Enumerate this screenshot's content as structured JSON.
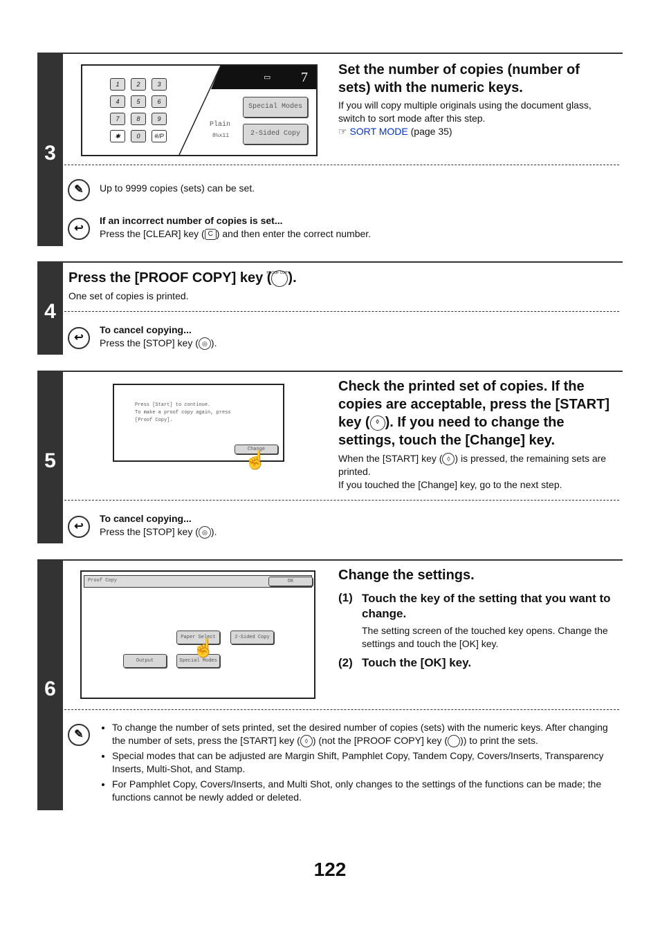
{
  "steps": [
    {
      "number": "3",
      "title": "Set the number of copies (number of sets) with the numeric keys.",
      "body": "If you will copy multiple originals using the document glass, switch to sort mode after this step.",
      "ref_link": "SORT MODE",
      "ref_page": "(page 35)",
      "screen": {
        "keys": [
          "1",
          "2",
          "3",
          "4",
          "5",
          "6",
          "7",
          "8",
          "9",
          "✱",
          "0",
          "#/P"
        ],
        "count": "7",
        "paper_type": "Plain",
        "paper_size": "8½x11",
        "buttons": [
          "Special Modes",
          "2-Sided Copy"
        ]
      },
      "note": "Up to 9999 copies (sets) can be set.",
      "tip_title": "If an incorrect number of copies is set...",
      "tip_pre": "Press the [CLEAR] key (",
      "tip_key": "C",
      "tip_post": ") and then enter the correct number."
    },
    {
      "number": "4",
      "title_pre": "Press the [PROOF COPY] key (",
      "title_post": ").",
      "key_label": "PROOF COPY",
      "body": "One set of copies is printed.",
      "tip_title": "To cancel copying...",
      "tip_pre": "Press the [STOP] key (",
      "tip_post": ")."
    },
    {
      "number": "5",
      "title_a": "Check the printed set of copies. If the copies are acceptable, press the [START] key (",
      "title_b": "). If you need to change the settings, touch the [Change] key.",
      "body1_pre": "When the [START] key (",
      "body1_post": ") is pressed, the remaining sets are printed.",
      "body2": "If you touched the [Change] key, go to the next step.",
      "screen": {
        "lines": [
          "Press [Start] to continue.",
          "To make a proof copy again, press",
          "[Proof Copy]."
        ],
        "button": "Change"
      },
      "tip_title": "To cancel copying...",
      "tip_pre": "Press the [STOP] key (",
      "tip_post": ")."
    },
    {
      "number": "6",
      "title": "Change the settings.",
      "sub1_num": "(1)",
      "sub1": "Touch the key of the setting that you want to change.",
      "sub1_body": "The setting screen of the touched key opens. Change the settings and touch the [OK] key.",
      "sub2_num": "(2)",
      "sub2": "Touch the [OK] key.",
      "screen": {
        "title": "Proof Copy",
        "ok": "OK",
        "buttons": [
          "Paper Select",
          "2-Sided Copy",
          "Output",
          "Special Modes"
        ]
      },
      "notes": [
        {
          "pre": "To change the number of sets printed, set the desired number of copies (sets) with the numeric keys. After changing the number of sets, press the [START] key (",
          "mid": ") (not the [PROOF COPY] key (",
          "post": ")) to print the sets."
        },
        {
          "text": "Special modes that can be adjusted are Margin Shift, Pamphlet Copy, Tandem Copy, Covers/Inserts, Transparency Inserts, Multi-Shot, and Stamp."
        },
        {
          "text": "For Pamphlet Copy, Covers/Inserts, and Multi Shot, only changes to the settings of the functions can be made; the functions cannot be newly added or deleted."
        }
      ]
    }
  ],
  "page_number": "122"
}
